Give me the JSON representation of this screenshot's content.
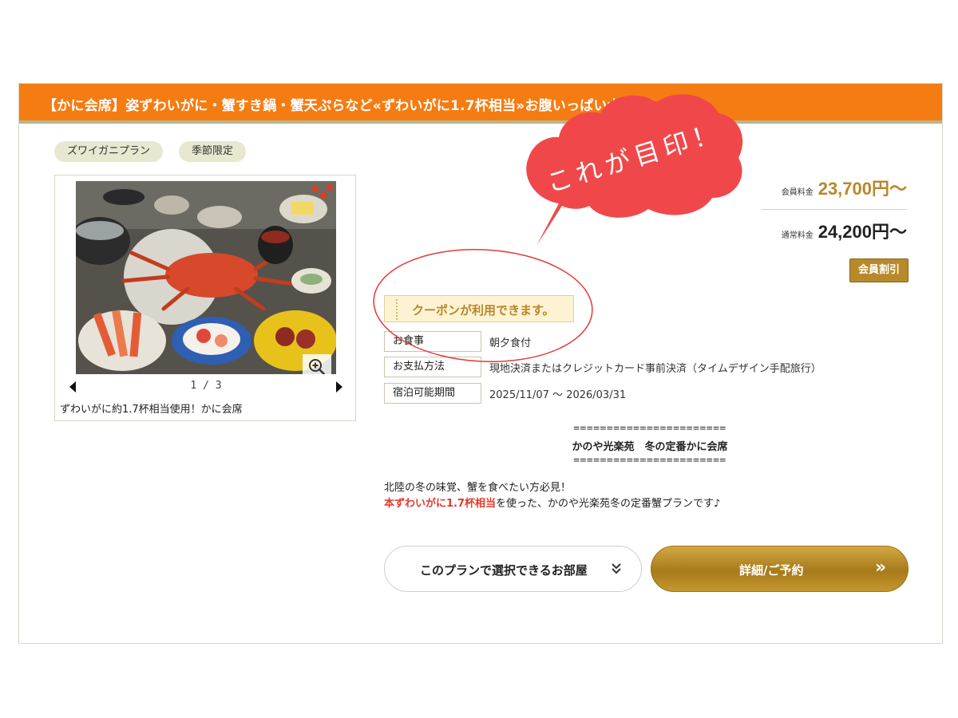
{
  "plan": {
    "title": "【かに会席】姿ずわいがに・蟹すき鍋・蟹天ぷらなど«ずわいがに1.7杯相当»お腹いっぱい大満足！",
    "tags": [
      "ズワイガニプラン",
      "季節限定"
    ],
    "photo": {
      "counter": "1 / 3",
      "caption": "ずわいがに約1.7杯相当使用！かに会席"
    },
    "prices": {
      "member_label": "会員料金",
      "member_price": "23,700円〜",
      "normal_label": "通常料金",
      "normal_price": "24,200円〜",
      "member_badge": "会員割引"
    },
    "coupon_text": "クーポンが利用できます。",
    "info": [
      {
        "label": "お食事",
        "value": "朝夕食付"
      },
      {
        "label": "お支払方法",
        "value": "現地決済またはクレジットカード事前決済（タイムデザイン手配旅行）"
      },
      {
        "label": "宿泊可能期間",
        "value": "2025/11/07 〜 2026/03/31"
      }
    ],
    "description": {
      "separator": "=======================",
      "heading": "かのや光楽苑　冬の定番かに会席",
      "line1": "北陸の冬の味覚、蟹を食べたい方必見！",
      "line2_highlight": "本ずわいがに1.7杯相当",
      "line2_rest": "を使った、かのや光楽苑冬の定番蟹プランです♪"
    },
    "buttons": {
      "rooms": "このプランで選択できるお部屋",
      "reserve": "詳細/ご予約",
      "reserve_arrow": "»"
    }
  },
  "annotation": {
    "bubble_text": "これが目印！",
    "bubble_color": "#f0484a",
    "circle_color": "#e33a3a"
  },
  "colors": {
    "title_bar": "#f57c12",
    "gold": "#b8862a",
    "highlight_red": "#e43a2a"
  }
}
